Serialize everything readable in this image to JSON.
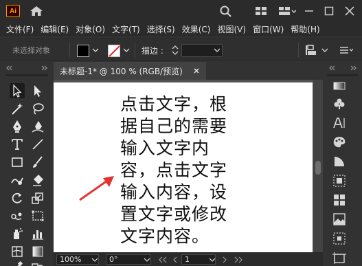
{
  "app": {
    "logo_text": "Ai"
  },
  "menu": [
    "文件(F)",
    "编辑(E)",
    "对象(O)",
    "文字(T)",
    "选择(S)",
    "效果(C)",
    "视图(V)",
    "窗口(W)",
    "帮助(H)"
  ],
  "control": {
    "selection_status": "未选择对象",
    "stroke_label": "描边 :",
    "fill_color": "#000000",
    "stroke_color": "none"
  },
  "document": {
    "tab_title": "未标题-1* @ 100 % (RGB/预览)",
    "text_lines": [
      "点击文字，根",
      "据自己的需要",
      "输入文字内",
      "容，点击文字",
      "输入内容，设",
      "置文字或修改",
      "文字内容。"
    ]
  },
  "status": {
    "zoom": "100%",
    "rotation": "0°",
    "artboard": "1"
  },
  "colors": {
    "annotation_arrow": "#e3342f",
    "app_accent": "#ff9a00"
  },
  "icons": {
    "titlebar": [
      "home-icon",
      "search-icon",
      "workspace-layout-icon",
      "arrange-documents-icon",
      "minimize-icon",
      "maximize-icon",
      "close-icon"
    ],
    "left_tools": [
      "selection-tool",
      "direct-selection-tool",
      "magic-wand-tool",
      "lasso-tool",
      "pen-tool",
      "curvature-tool",
      "type-tool",
      "line-segment-tool",
      "rectangle-tool",
      "paintbrush-tool",
      "shaper-tool",
      "eraser-tool",
      "rotate-tool",
      "scale-tool",
      "puppet-warp-tool",
      "free-transform-tool",
      "symbol-sprayer-tool",
      "column-graph-tool",
      "mesh-tool",
      "gradient-tool",
      "eyedropper-tool",
      "blend-tool"
    ],
    "right_panels": [
      "color-panel",
      "symbols-panel",
      "character-panel",
      "swatches-panel",
      "transparency-panel",
      "align-panel",
      "pathfinder-panel",
      "image-trace-panel",
      "links-panel",
      "artboards-panel"
    ]
  }
}
